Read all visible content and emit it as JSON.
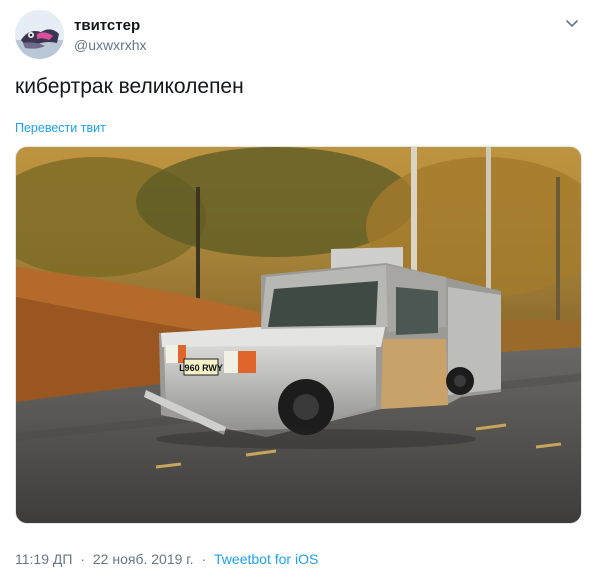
{
  "author": {
    "name": "твитстер",
    "handle": "@uxwxrxhx"
  },
  "icons": {
    "menu": "chevron-down-icon"
  },
  "tweet": {
    "text": "кибертрак великолепен",
    "translate_label": "Перевести твит"
  },
  "media": {
    "plate_text": "L960 RWY"
  },
  "meta": {
    "time": "11:19 ДП",
    "separator": "·",
    "date": "22 нояб. 2019 г.",
    "source": "Tweetbot for iOS"
  },
  "colors": {
    "link": "#1da1f2",
    "secondary_text": "#657786"
  }
}
